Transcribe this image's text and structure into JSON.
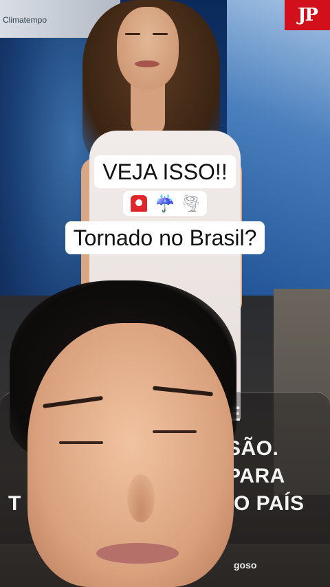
{
  "overlay": {
    "line1": "VEJA ISSO!!",
    "emojis": [
      "siren-icon",
      "umbrella-rain-icon",
      "tornado-icon"
    ],
    "line2": "Tornado no Brasil?"
  },
  "background": {
    "channel_label": "Climatempo",
    "logo_text": "JP",
    "lower_third": {
      "line_a": "E",
      "line_b": "SÃO.",
      "line_c": "PARA",
      "line_d_left": "T",
      "line_d_right": "O PAÍS",
      "credit": "goso"
    }
  },
  "colors": {
    "logo_red": "#d1101c",
    "caption_bg": "#ffffff"
  }
}
